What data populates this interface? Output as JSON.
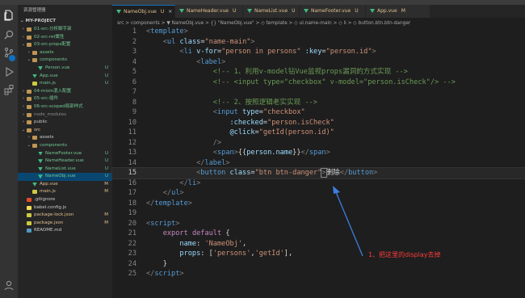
{
  "explorer": {
    "title": "资源管理器",
    "project": "MY-PROJECT",
    "items": [
      {
        "label": "01-src-分析脚手架",
        "type": "folder",
        "depth": 0,
        "open": false,
        "color": "#73c991",
        "badge": "",
        "selected": false
      },
      {
        "label": "02-src-ref属性",
        "type": "folder",
        "depth": 0,
        "open": false,
        "color": "#73c991",
        "badge": "",
        "selected": false
      },
      {
        "label": "03-src-props配置",
        "type": "folder",
        "depth": 0,
        "open": true,
        "color": "#73c991",
        "badge": "",
        "selected": false
      },
      {
        "label": "assets",
        "type": "folder",
        "depth": 1,
        "open": false,
        "color": "#73c991",
        "badge": "",
        "selected": false
      },
      {
        "label": "components",
        "type": "folder",
        "depth": 1,
        "open": true,
        "color": "#73c991",
        "badge": "",
        "selected": false
      },
      {
        "label": "Person.vue",
        "type": "vue",
        "depth": 2,
        "open": false,
        "color": "#73c991",
        "badge": "U",
        "selected": false
      },
      {
        "label": "App.vue",
        "type": "vue",
        "depth": 1,
        "open": false,
        "color": "#73c991",
        "badge": "U",
        "selected": false
      },
      {
        "label": "main.js",
        "type": "js",
        "depth": 1,
        "open": false,
        "color": "#73c991",
        "badge": "U",
        "selected": false
      },
      {
        "label": "04-mixin混入配置",
        "type": "folder",
        "depth": 0,
        "open": false,
        "color": "#73c991",
        "badge": "",
        "selected": false
      },
      {
        "label": "05-src-插件",
        "type": "folder",
        "depth": 0,
        "open": false,
        "color": "#73c991",
        "badge": "",
        "selected": false
      },
      {
        "label": "06-src-scoped局部样式",
        "type": "folder",
        "depth": 0,
        "open": false,
        "color": "#73c991",
        "badge": "",
        "selected": false
      },
      {
        "label": "node_modules",
        "type": "folder",
        "depth": 0,
        "open": false,
        "color": "#8c8c8c",
        "badge": "",
        "selected": false
      },
      {
        "label": "public",
        "type": "folder",
        "depth": 0,
        "open": false,
        "color": "#cccccc",
        "badge": "",
        "selected": false
      },
      {
        "label": "src",
        "type": "folder",
        "depth": 0,
        "open": true,
        "color": "#e2c08d",
        "badge": "",
        "selected": false
      },
      {
        "label": "assets",
        "type": "folder",
        "depth": 1,
        "open": false,
        "color": "#cccccc",
        "badge": "",
        "selected": false
      },
      {
        "label": "components",
        "type": "folder",
        "depth": 1,
        "open": true,
        "color": "#73c991",
        "badge": "",
        "selected": false
      },
      {
        "label": "NameFooter.vue",
        "type": "vue",
        "depth": 2,
        "open": false,
        "color": "#73c991",
        "badge": "U",
        "selected": false
      },
      {
        "label": "NameHeader.vue",
        "type": "vue",
        "depth": 2,
        "open": false,
        "color": "#73c991",
        "badge": "U",
        "selected": false
      },
      {
        "label": "NameList.vue",
        "type": "vue",
        "depth": 2,
        "open": false,
        "color": "#73c991",
        "badge": "U",
        "selected": false
      },
      {
        "label": "NameObj.vue",
        "type": "vue",
        "depth": 2,
        "open": false,
        "color": "#73c991",
        "badge": "U",
        "selected": true
      },
      {
        "label": "App.vue",
        "type": "vue",
        "depth": 1,
        "open": false,
        "color": "#e2c08d",
        "badge": "M",
        "selected": false
      },
      {
        "label": "main.js",
        "type": "js",
        "depth": 1,
        "open": false,
        "color": "#e2c08d",
        "badge": "M",
        "selected": false
      },
      {
        "label": ".gitignore",
        "type": "git",
        "depth": 0,
        "open": false,
        "color": "#cccccc",
        "badge": "",
        "selected": false
      },
      {
        "label": "babel.config.js",
        "type": "babel",
        "depth": 0,
        "open": false,
        "color": "#cccccc",
        "badge": "",
        "selected": false
      },
      {
        "label": "package-lock.json",
        "type": "json",
        "depth": 0,
        "open": false,
        "color": "#e2c08d",
        "badge": "M",
        "selected": false
      },
      {
        "label": "package.json",
        "type": "json",
        "depth": 0,
        "open": false,
        "color": "#e2c08d",
        "badge": "M",
        "selected": false
      },
      {
        "label": "README.md",
        "type": "md",
        "depth": 0,
        "open": false,
        "color": "#cccccc",
        "badge": "",
        "selected": false
      }
    ]
  },
  "tabs": [
    {
      "name": "NameObj.vue",
      "badge": "U",
      "active": true,
      "close": "×"
    },
    {
      "name": "NameHeader.vue",
      "badge": "U",
      "active": false,
      "close": ""
    },
    {
      "name": "NameList.vue",
      "badge": "U",
      "active": false,
      "close": ""
    },
    {
      "name": "NameFooter.vue",
      "badge": "U",
      "active": false,
      "close": ""
    },
    {
      "name": "App.vue",
      "badge": "M",
      "active": false,
      "close": ""
    }
  ],
  "breadcrumb": "src > components > ▼ NameObj.vue > {} \"NameObj.vue\" > ◇ template > ◇ ul.name-main > ◇ li > ◇ button.btn.btn-danger",
  "editor": {
    "current_line": 15,
    "lines": [
      [
        [
          "t-punc",
          "<"
        ],
        [
          "t-tag",
          "template"
        ],
        [
          "t-punc",
          ">"
        ]
      ],
      [
        [
          "t-text",
          "    "
        ],
        [
          "t-punc",
          "<"
        ],
        [
          "t-tag",
          "ul"
        ],
        [
          "t-text",
          " "
        ],
        [
          "t-attr",
          "class"
        ],
        [
          "t-text",
          "="
        ],
        [
          "t-str",
          "\"name-main\""
        ],
        [
          "t-punc",
          ">"
        ]
      ],
      [
        [
          "t-text",
          "        "
        ],
        [
          "t-punc",
          "<"
        ],
        [
          "t-tag",
          "li"
        ],
        [
          "t-text",
          " "
        ],
        [
          "t-attr",
          "v-for"
        ],
        [
          "t-text",
          "="
        ],
        [
          "t-str",
          "\"person in persons\""
        ],
        [
          "t-text",
          " "
        ],
        [
          "t-attr",
          ":key"
        ],
        [
          "t-text",
          "="
        ],
        [
          "t-str",
          "\"person.id\""
        ],
        [
          "t-punc",
          ">"
        ]
      ],
      [
        [
          "t-text",
          "            "
        ],
        [
          "t-punc",
          "<"
        ],
        [
          "t-tag",
          "label"
        ],
        [
          "t-punc",
          ">"
        ]
      ],
      [
        [
          "t-text",
          "                "
        ],
        [
          "t-com",
          "<!-- 1、利用v-model钻Vue监视props漏洞的方式实现 -->"
        ]
      ],
      [
        [
          "t-text",
          "                "
        ],
        [
          "t-com",
          "<!-- <input type=\"checkbox\" v-model=\"person.isCheck\"/> -->"
        ]
      ],
      [],
      [
        [
          "t-text",
          "                "
        ],
        [
          "t-com",
          "<!-- 2、按照逻辑老实实现 -->"
        ]
      ],
      [
        [
          "t-text",
          "                "
        ],
        [
          "t-punc",
          "<"
        ],
        [
          "t-tag",
          "input"
        ],
        [
          "t-text",
          " "
        ],
        [
          "t-attr",
          "type"
        ],
        [
          "t-text",
          "="
        ],
        [
          "t-str",
          "\"checkbox\""
        ]
      ],
      [
        [
          "t-text",
          "                    "
        ],
        [
          "t-attr",
          ":checked"
        ],
        [
          "t-text",
          "="
        ],
        [
          "t-str",
          "\"person.isCheck\""
        ]
      ],
      [
        [
          "t-text",
          "                    "
        ],
        [
          "t-attr",
          "@click"
        ],
        [
          "t-text",
          "="
        ],
        [
          "t-str",
          "\"getId(person.id)\""
        ]
      ],
      [
        [
          "t-text",
          "                "
        ],
        [
          "t-punc",
          "/>"
        ]
      ],
      [
        [
          "t-text",
          "                "
        ],
        [
          "t-punc",
          "<"
        ],
        [
          "t-tag",
          "span"
        ],
        [
          "t-punc",
          ">"
        ],
        [
          "t-text",
          "{{"
        ],
        [
          "t-attr",
          "person.name"
        ],
        [
          "t-text",
          "}}"
        ],
        [
          "t-punc",
          "</"
        ],
        [
          "t-tag",
          "span"
        ],
        [
          "t-punc",
          ">"
        ]
      ],
      [
        [
          "t-text",
          "            "
        ],
        [
          "t-punc",
          "</"
        ],
        [
          "t-tag",
          "label"
        ],
        [
          "t-punc",
          ">"
        ]
      ],
      [
        [
          "t-text",
          "            "
        ],
        [
          "t-punc",
          "<"
        ],
        [
          "t-tag",
          "button"
        ],
        [
          "t-text",
          " "
        ],
        [
          "t-attr",
          "class"
        ],
        [
          "t-text",
          "="
        ],
        [
          "t-str",
          "\"btn btn-danger\""
        ],
        [
          "t-punc",
          ">"
        ],
        [
          "t-text",
          "删除"
        ],
        [
          "t-punc",
          "</"
        ],
        [
          "t-tag",
          "button"
        ],
        [
          "t-punc",
          ">"
        ]
      ],
      [
        [
          "t-text",
          "        "
        ],
        [
          "t-punc",
          "</"
        ],
        [
          "t-tag",
          "li"
        ],
        [
          "t-punc",
          ">"
        ]
      ],
      [
        [
          "t-text",
          "    "
        ],
        [
          "t-punc",
          "</"
        ],
        [
          "t-tag",
          "ul"
        ],
        [
          "t-punc",
          ">"
        ]
      ],
      [
        [
          "t-punc",
          "</"
        ],
        [
          "t-tag",
          "template"
        ],
        [
          "t-punc",
          ">"
        ]
      ],
      [],
      [
        [
          "t-punc",
          "<"
        ],
        [
          "t-tag",
          "script"
        ],
        [
          "t-punc",
          ">"
        ]
      ],
      [
        [
          "t-text",
          "    "
        ],
        [
          "t-key",
          "export"
        ],
        [
          "t-text",
          " "
        ],
        [
          "t-key",
          "default"
        ],
        [
          "t-text",
          " {"
        ]
      ],
      [
        [
          "t-text",
          "        "
        ],
        [
          "t-attr",
          "name"
        ],
        [
          "t-text",
          ": "
        ],
        [
          "t-str",
          "'NameObj'"
        ],
        [
          "t-text",
          ","
        ]
      ],
      [
        [
          "t-text",
          "        "
        ],
        [
          "t-attr",
          "props"
        ],
        [
          "t-text",
          ": ["
        ],
        [
          "t-str",
          "'persons'"
        ],
        [
          "t-text",
          ","
        ],
        [
          "t-str",
          "'getId'"
        ],
        [
          "t-text",
          "],"
        ]
      ],
      [
        [
          "t-text",
          "    }"
        ]
      ],
      [
        [
          "t-punc",
          "</"
        ],
        [
          "t-tag",
          "script"
        ],
        [
          "t-punc",
          ">"
        ]
      ]
    ]
  },
  "annotation": {
    "text": "1、把这里的display去掉",
    "color": "#ff3b3b"
  },
  "icons": [
    "explorer-icon",
    "search-icon",
    "source-control-icon",
    "run-debug-icon",
    "extensions-icon",
    "account-icon"
  ]
}
